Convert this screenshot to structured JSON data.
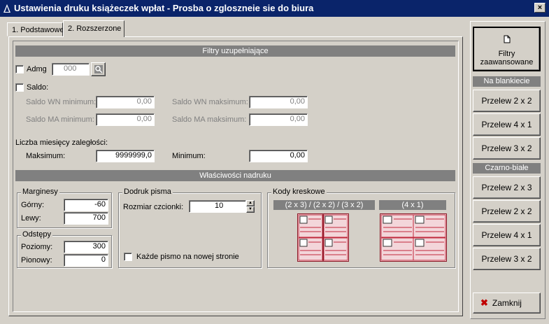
{
  "window": {
    "title": "Ustawienia druku książeczek wpłat - Prosba o zgloszneie sie do biura",
    "close_label": "×"
  },
  "tabs": [
    {
      "label": "1. Podstawowe"
    },
    {
      "label": "2. Rozszerzone"
    }
  ],
  "filters": {
    "header": "Filtry uzupełniające",
    "admg_label": "Admg",
    "admg_value": "000",
    "saldo_label": "Saldo:",
    "saldo_wn_min_label": "Saldo WN minimum:",
    "saldo_wn_min_value": "0,00",
    "saldo_wn_max_label": "Saldo WN maksimum:",
    "saldo_wn_max_value": "0,00",
    "saldo_ma_min_label": "Saldo MA minimum:",
    "saldo_ma_min_value": "0,00",
    "saldo_ma_max_label": "Saldo MA maksimum:",
    "saldo_ma_max_value": "0,00",
    "months_label": "Liczba miesięcy zaległości:",
    "max_label": "Maksimum:",
    "max_value": "9999999,0",
    "min_label": "Minimum:",
    "min_value": "0,00"
  },
  "print": {
    "header": "Właściwości nadruku",
    "margins_title": "Marginesy",
    "top_label": "Górny:",
    "top_value": "-60",
    "left_label": "Lewy:",
    "left_value": "700",
    "spacing_title": "Odstępy",
    "horiz_label": "Poziomy:",
    "horiz_value": "300",
    "vert_label": "Pionowy:",
    "vert_value": "0",
    "letter_title": "Dodruk pisma",
    "font_size_label": "Rozmiar czcionki:",
    "font_size_value": "10",
    "each_letter_label": "Każde pismo na nowej stronie",
    "barcodes_title": "Kody kreskowe",
    "barcode_a_label": "(2 x 3) / (2 x 2) / (3 x 2)",
    "barcode_b_label": "(4 x 1)"
  },
  "side": {
    "advanced_filters_line1": "Filtry",
    "advanced_filters_line2": "zaawansowane",
    "blank_section": "Na blankiecie",
    "blank_buttons": [
      "Przelew 2 x 2",
      "Przelew 4 x 1",
      "Przelew 3 x 2"
    ],
    "bw_section": "Czarno-białe",
    "bw_buttons": [
      "Przelew 2 x 3",
      "Przelew 2 x 2",
      "Przelew 4 x 1",
      "Przelew 3 x 2"
    ],
    "close_label": "Zamknij"
  },
  "colors": {
    "titlebar": "#0a246a",
    "window_bg": "#d4d0c8",
    "section_header": "#808080",
    "barcode_red": "#c0283c"
  }
}
